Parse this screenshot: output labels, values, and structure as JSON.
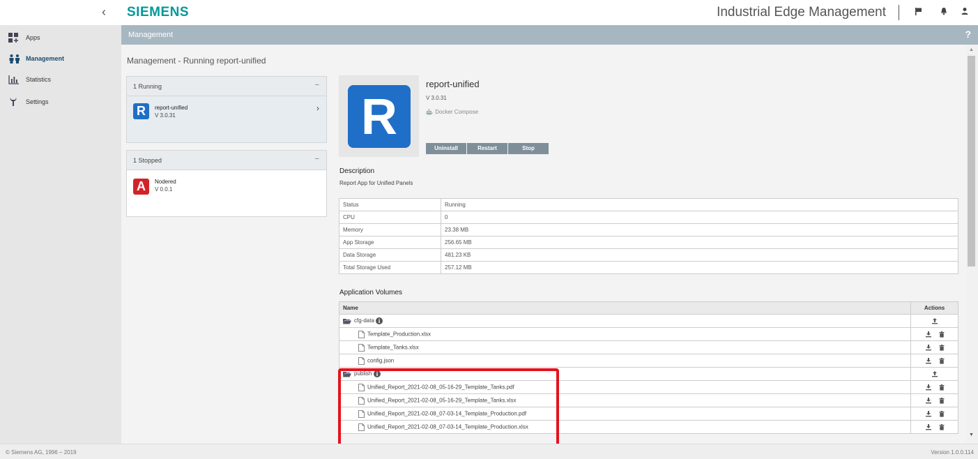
{
  "header": {
    "collapse_glyph": "‹",
    "logo": "SIEMENS",
    "title": "Industrial Edge Management",
    "icons": [
      "flag-icon",
      "bell-icon",
      "user-icon"
    ]
  },
  "sidebar": {
    "items": [
      {
        "label": "Apps",
        "icon": "apps-icon",
        "active": false
      },
      {
        "label": "Management",
        "icon": "management-icon",
        "active": true
      },
      {
        "label": "Statistics",
        "icon": "statistics-icon",
        "active": false
      },
      {
        "label": "Settings",
        "icon": "settings-icon",
        "active": false
      }
    ]
  },
  "section_header": {
    "title": "Management",
    "help": "?"
  },
  "page_title": "Management - Running report-unified",
  "running_group": {
    "title": "1 Running",
    "toggle": "−",
    "app": {
      "icon_letter": "R",
      "name": "report-unified",
      "version": "V 3.0.31",
      "arrow": "›"
    }
  },
  "stopped_group": {
    "title": "1 Stopped",
    "toggle": "−",
    "app": {
      "icon_letter": "A",
      "name": "Nodered",
      "version": "V 0.0.1"
    }
  },
  "detail": {
    "icon_letter": "R",
    "name": "report-unified",
    "version": "V 3.0.31",
    "type": "Docker Compose",
    "buttons": {
      "uninstall": "Uninstall",
      "restart": "Restart",
      "stop": "Stop"
    },
    "description_title": "Description",
    "description": "Report App for Unified Panels"
  },
  "stats": [
    {
      "key": "Status",
      "value": "Running"
    },
    {
      "key": "CPU",
      "value": "0"
    },
    {
      "key": "Memory",
      "value": "23.38 MB"
    },
    {
      "key": "App Storage",
      "value": "256.65 MB"
    },
    {
      "key": "Data Storage",
      "value": "481.23 KB"
    },
    {
      "key": "Total Storage Used",
      "value": "257.12 MB"
    }
  ],
  "volumes": {
    "title": "Application Volumes",
    "col_name": "Name",
    "col_actions": "Actions",
    "folders": [
      {
        "name": "cfg-data",
        "files": [
          "Template_Production.xlsx",
          "Template_Tanks.xlsx",
          "config.json"
        ]
      },
      {
        "name": "publish",
        "files": [
          "Unified_Report_2021-02-08_05-16-29_Template_Tanks.pdf",
          "Unified_Report_2021-02-08_05-16-29_Template_Tanks.xlsx",
          "Unified_Report_2021-02-08_07-03-14_Template_Production.pdf",
          "Unified_Report_2021-02-08_07-03-14_Template_Production.xlsx"
        ]
      }
    ]
  },
  "footer": {
    "copyright": "© Siemens AG, 1996 – 2019",
    "version": "Version 1.0.0.114"
  },
  "colors": {
    "accent": "#009999",
    "highlight": "#e3131e",
    "button": "#7e8f9a",
    "app_blue": "#1f6fc8",
    "app_red": "#d2232a"
  }
}
